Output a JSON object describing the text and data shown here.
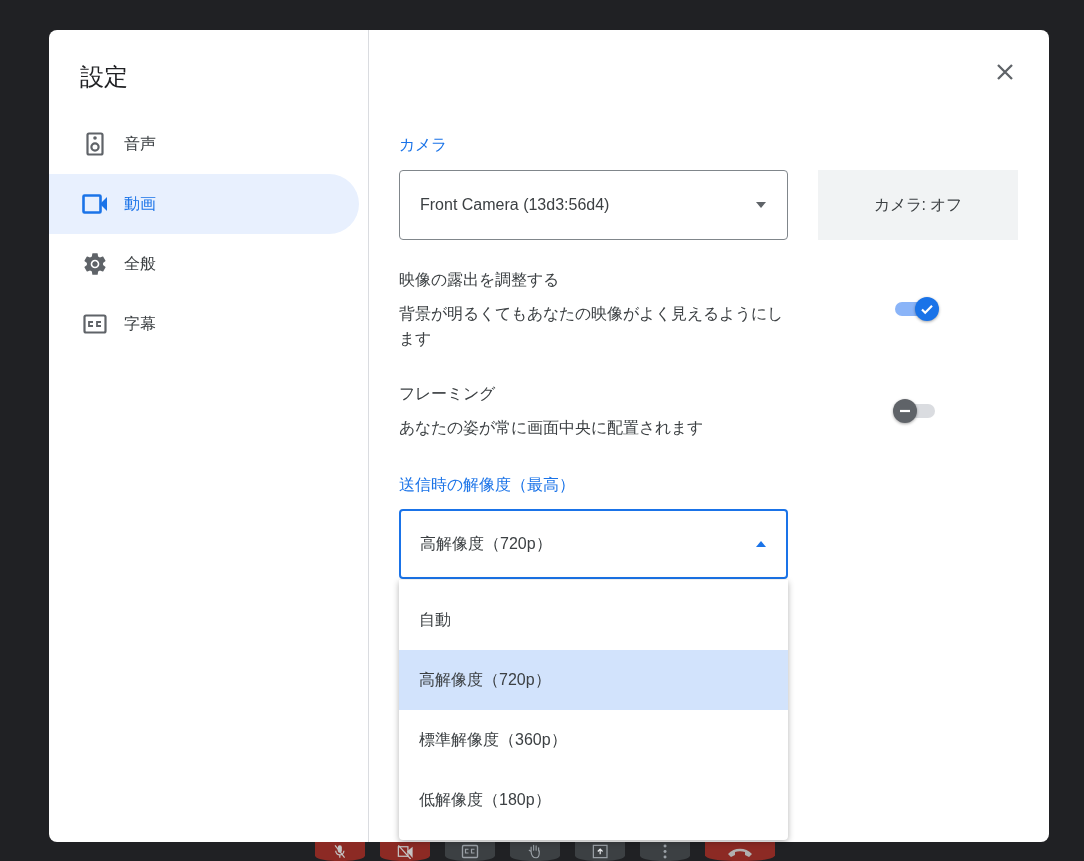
{
  "dialog": {
    "title": "設定"
  },
  "sidebar": {
    "items": [
      {
        "label": "音声",
        "kind": "speaker",
        "selected": false
      },
      {
        "label": "動画",
        "kind": "video",
        "selected": true
      },
      {
        "label": "全般",
        "kind": "gear",
        "selected": false
      },
      {
        "label": "字幕",
        "kind": "captions",
        "selected": false
      }
    ]
  },
  "camera": {
    "heading": "カメラ",
    "select_value": "Front Camera (13d3:56d4)",
    "button": "カメラ: オフ"
  },
  "toggles": [
    {
      "title": "映像の露出を調整する",
      "description": "背景が明るくてもあなたの映像がよく見えるようにします",
      "on": true
    },
    {
      "title": "フレーミング",
      "description": "あなたの姿が常に画面中央に配置されます",
      "on": false
    }
  ],
  "resolution": {
    "heading": "送信時の解像度（最高）",
    "select_value": "高解像度（720p）",
    "expanded": true,
    "options": [
      {
        "label": "自動",
        "selected": false
      },
      {
        "label": "高解像度（720p）",
        "selected": true
      },
      {
        "label": "標準解像度（360p）",
        "selected": false
      },
      {
        "label": "低解像度（180p）",
        "selected": false
      }
    ]
  },
  "call_controls": [
    {
      "kind": "mic-off"
    },
    {
      "kind": "camera-off"
    },
    {
      "kind": "captions"
    },
    {
      "kind": "hand"
    },
    {
      "kind": "present"
    },
    {
      "kind": "more"
    },
    {
      "kind": "end-call"
    }
  ]
}
